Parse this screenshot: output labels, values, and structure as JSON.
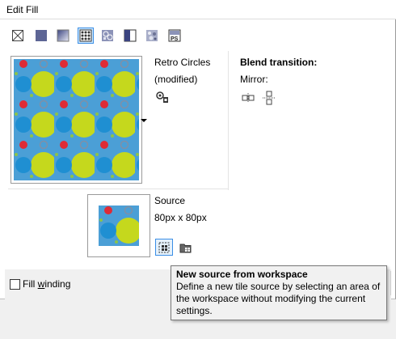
{
  "window": {
    "title": "Edit Fill"
  },
  "fill_types": [
    {
      "name": "no-fill-icon",
      "selected": false
    },
    {
      "name": "uniform-fill-icon",
      "selected": false
    },
    {
      "name": "fountain-fill-icon",
      "selected": false
    },
    {
      "name": "vector-pattern-fill-icon",
      "selected": true
    },
    {
      "name": "bitmap-pattern-fill-icon",
      "selected": false
    },
    {
      "name": "two-color-pattern-fill-icon",
      "selected": false
    },
    {
      "name": "texture-fill-icon",
      "selected": false
    },
    {
      "name": "postscript-fill-icon",
      "selected": false
    }
  ],
  "pattern": {
    "name": "Retro Circles",
    "state": "(modified)"
  },
  "blend": {
    "title": "Blend transition:",
    "mirror_label": "Mirror:"
  },
  "source": {
    "label": "Source",
    "size": "80px x 80px"
  },
  "options": {
    "fill_winding_pre": "Fill ",
    "fill_winding_ul": "w",
    "fill_winding_post": "inding",
    "fill_winding_checked": false
  },
  "tooltip": {
    "title": "New source from workspace",
    "body": "Define a new tile source by selecting an area of the workspace without modifying the current settings."
  },
  "colors": {
    "pattern_bg": "#4b9fd6",
    "circle_lime": "#c5d81d",
    "circle_blue": "#1f8fd2",
    "circle_red": "#de2b36",
    "ring": "#7f90a6",
    "selection_border": "#3a8ee6",
    "selection_fill": "#cce8ff"
  }
}
